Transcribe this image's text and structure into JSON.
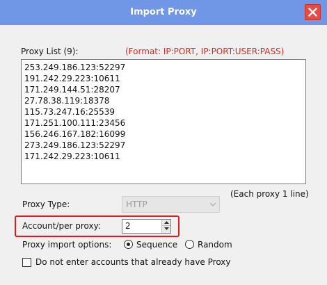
{
  "window": {
    "title": "Import Proxy"
  },
  "icons": {
    "close": "close-icon",
    "combo_arrow": "chevron-down-icon",
    "spin_up": "arrow-up-icon",
    "spin_down": "arrow-down-icon"
  },
  "colors": {
    "titlebar": "#6f97e5",
    "close_button": "#e44c45",
    "format_hint": "#e0281f",
    "highlight": "#e21b1b"
  },
  "proxy_list": {
    "label": "Proxy List (9):",
    "format_hint": "(Format: IP:PORT, IP:PORT:USER:PASS)",
    "items": [
      "253.249.186.123:52297",
      "191.242.29.223:10611",
      "171.249.144.51:28207",
      "27.78.38.119:18378",
      "115.73.247.16:25539",
      "171.251.100.111:23456",
      "156.246.167.182:16099",
      "273.249.186.123:52297",
      "171.242.29.223:10611"
    ],
    "note": "(Each proxy 1 line)"
  },
  "proxy_type": {
    "label": "Proxy Type:",
    "value": "HTTP"
  },
  "account_per_proxy": {
    "label": "Account/per proxy:",
    "value": "2"
  },
  "import_options": {
    "label": "Proxy import options:",
    "options": [
      "Sequence",
      "Random"
    ],
    "selected": "Sequence"
  },
  "skip_existing": {
    "label": "Do not enter accounts that already have Proxy",
    "checked": false
  }
}
